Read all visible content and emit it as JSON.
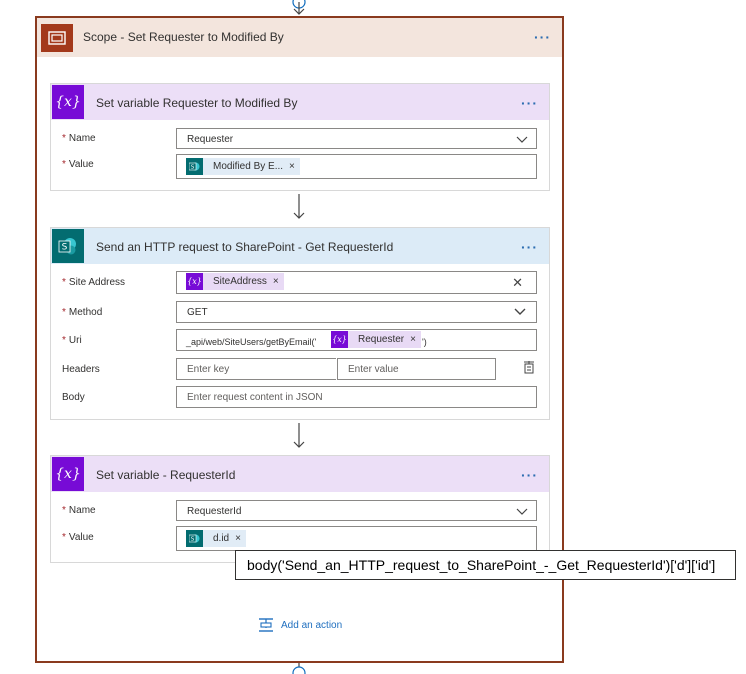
{
  "scope": {
    "title": "Scope - Set Requester to Modified By",
    "icon": "scope-icon",
    "menu": "···"
  },
  "card1": {
    "title": "Set variable Requester to Modified By",
    "icon": "variable-icon",
    "menu": "···",
    "name_label": "Name",
    "name_value": "Requester",
    "value_label": "Value",
    "value_token": "Modified By E...",
    "token_remove": "×"
  },
  "card2": {
    "title": "Send an HTTP request to SharePoint - Get RequesterId",
    "icon": "sharepoint-icon",
    "menu": "···",
    "site_label": "Site Address",
    "site_token": "SiteAddress",
    "token_remove": "×",
    "clear": "✕",
    "method_label": "Method",
    "method_value": "GET",
    "uri_label": "Uri",
    "uri_prefix": "_api/web/SiteUsers/getByEmail('",
    "uri_token": "Requester",
    "uri_suffix": "')",
    "headers_label": "Headers",
    "key_placeholder": "Enter key",
    "value_placeholder": "Enter value",
    "body_label": "Body",
    "body_placeholder": "Enter request content in JSON"
  },
  "card3": {
    "title": "Set variable - RequesterId",
    "icon": "variable-icon",
    "menu": "···",
    "name_label": "Name",
    "name_value": "RequesterId",
    "value_label": "Value",
    "value_token": "d.id",
    "token_remove": "×"
  },
  "required_marker": "*",
  "tooltip": "body('Send_an_HTTP_request_to_SharePoint_-_Get_RequesterId')['d']['id']",
  "add_action": "Add an action",
  "colors": {
    "scope_accent": "#a3391b",
    "variable_accent": "#770bd6",
    "sharepoint_accent": "#036c70",
    "link": "#1f6fbf"
  }
}
